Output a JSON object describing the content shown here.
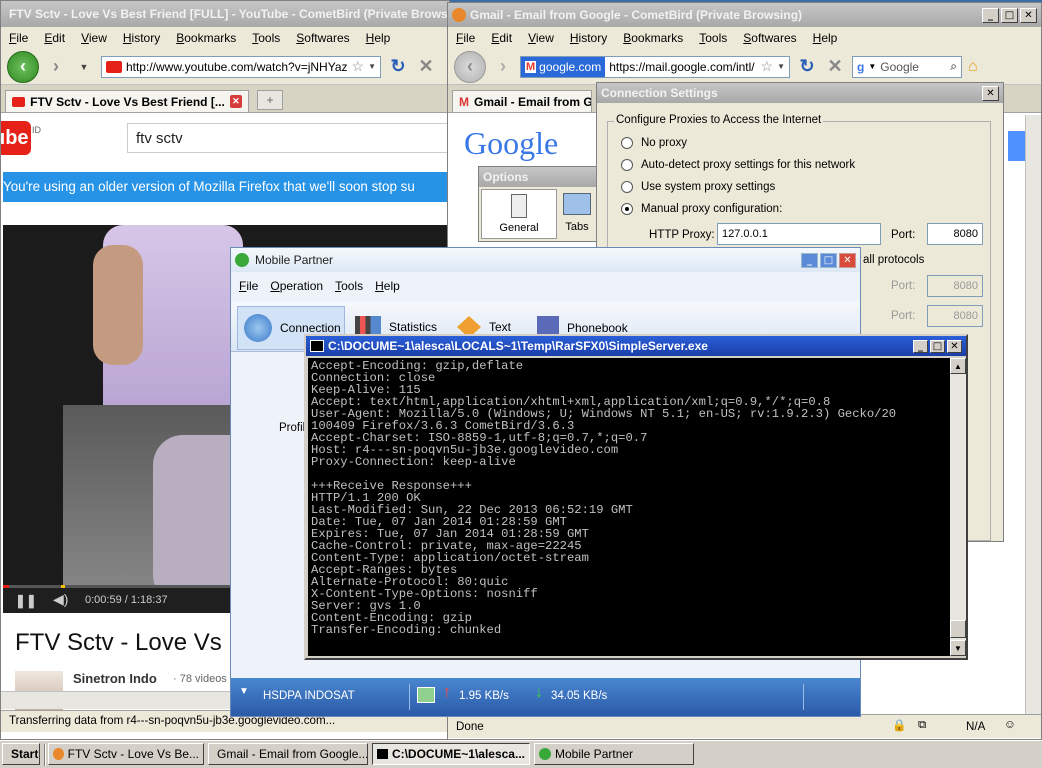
{
  "youtube_window": {
    "title": "FTV Sctv - Love Vs Best Friend [FULL] - YouTube - CometBird (Private Brows",
    "menu": [
      "File",
      "Edit",
      "View",
      "History",
      "Bookmarks",
      "Tools",
      "Softwares",
      "Help"
    ],
    "url": "http://www.youtube.com/watch?v=jNHYaz",
    "tab_label": "FTV Sctv - Love Vs Best Friend [...",
    "logo_text": "ube",
    "logo_sup": "ID",
    "search_value": "ftv sctv",
    "banner_text": "You're using an older version of Mozilla Firefox that we'll soon stop su",
    "video_time": "0:00:59 / 1:18:37",
    "video_progress": 0.0125,
    "video_title": "FTV Sctv - Love Vs I",
    "channel_name": "Sinetron Indo",
    "channel_videos": "· 78 videos",
    "status": "Transferring data from r4---sn-poqvn5u-jb3e.googlevideo.com..."
  },
  "gmail_window": {
    "title": "Gmail - Email from Google - CometBird (Private Browsing)",
    "menu": [
      "File",
      "Edit",
      "View",
      "History",
      "Bookmarks",
      "Tools",
      "Softwares",
      "Help"
    ],
    "identity": "google.com",
    "url": "https://mail.google.com/intl/",
    "search_placeholder": "Google",
    "tab_label": "Gmail - Email from G",
    "google_logo": "Google",
    "status": "Done",
    "status_na": "N/A"
  },
  "options_dialog": {
    "title": "Options",
    "general_label": "General",
    "tabs_label": "Tabs"
  },
  "connection_dialog": {
    "title": "Connection Settings",
    "group_label": "Configure Proxies to Access the Internet",
    "no_proxy": "No proxy",
    "auto_detect": "Auto-detect proxy settings for this network",
    "system_proxy": "Use system proxy settings",
    "manual_proxy": "Manual proxy configuration:",
    "http_proxy_label": "HTTP Proxy:",
    "http_proxy_value": "127.0.0.1",
    "port_label": "Port:",
    "port_value": "8080",
    "all_protocols": "all protocols",
    "port_label_2": "Port:",
    "port_value_2": "8080",
    "port_label_3": "Port:",
    "port_value_3": "8080"
  },
  "mobile_partner": {
    "title": "Mobile Partner",
    "menu": [
      "File",
      "Operation",
      "Tools",
      "Help"
    ],
    "tabs": [
      "Connection",
      "Statistics",
      "Text",
      "Phonebook"
    ],
    "profile_label": "Profil",
    "network": "HSDPA INDOSAT",
    "upload_speed": "1.95 KB/s",
    "download_speed": "34.05 KB/s"
  },
  "console": {
    "title": "C:\\DOCUME~1\\alesca\\LOCALS~1\\Temp\\RarSFX0\\SimpleServer.exe",
    "text": "Accept-Encoding: gzip,deflate\nConnection: close\nKeep-Alive: 115\nAccept: text/html,application/xhtml+xml,application/xml;q=0.9,*/*;q=0.8\nUser-Agent: Mozilla/5.0 (Windows; U; Windows NT 5.1; en-US; rv:1.9.2.3) Gecko/20\n100409 Firefox/3.6.3 CometBird/3.6.3\nAccept-Charset: ISO-8859-1,utf-8;q=0.7,*;q=0.7\nHost: r4---sn-poqvn5u-jb3e.googlevideo.com\nProxy-Connection: keep-alive\n\n+++Receive Response+++\nHTTP/1.1 200 OK\nLast-Modified: Sun, 22 Dec 2013 06:52:19 GMT\nDate: Tue, 07 Jan 2014 01:28:59 GMT\nExpires: Tue, 07 Jan 2014 01:28:59 GMT\nCache-Control: private, max-age=22245\nContent-Type: application/octet-stream\nAccept-Ranges: bytes\nAlternate-Protocol: 80:quic\nX-Content-Type-Options: nosniff\nServer: gvs 1.0\nContent-Encoding: gzip\nTransfer-Encoding: chunked"
  },
  "taskbar": {
    "start": "Start",
    "items": [
      "FTV Sctv - Love Vs Be...",
      "Gmail - Email from Google...",
      "C:\\DOCUME~1\\alesca...",
      "Mobile Partner"
    ]
  },
  "colors": {
    "xp_blue": "#2a5fd8",
    "youtube_red": "#e62117",
    "banner_blue": "#2793e6",
    "taskbar": "#d4d0c8"
  }
}
